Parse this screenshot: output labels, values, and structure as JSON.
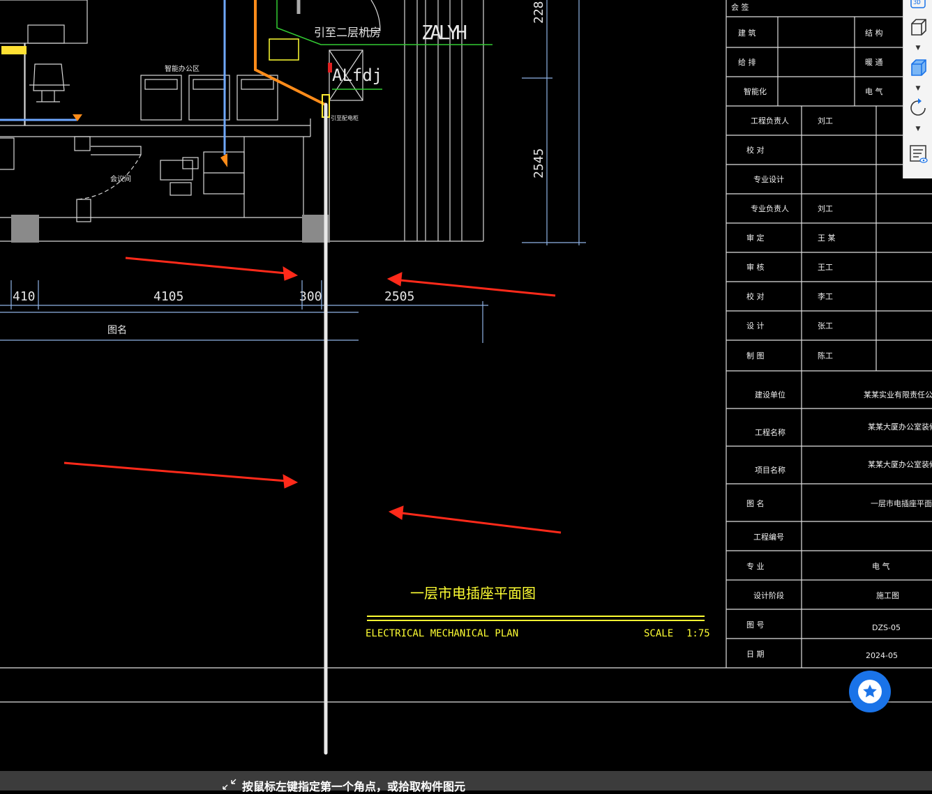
{
  "drawing": {
    "labels": {
      "to_machine_room": "引至二层机房",
      "zalyh": "ZALYH",
      "alfdj": "ALfdj",
      "intelligent_office": "智能办公区",
      "meeting_room": "会议间",
      "small_label": "引至配电柜"
    },
    "dimensions": {
      "d410": "410",
      "d4105": "4105",
      "d300": "300",
      "d2505": "2505",
      "d2545": "2545",
      "d228": "228",
      "figure_name": "图名"
    },
    "plan_title": "一层市电插座平面图",
    "plan_subtitle": "ELECTRICAL  MECHANICAL  PLAN",
    "scale_label": "SCALE",
    "scale_value": "1:75"
  },
  "title_block": {
    "rows": [
      {
        "k": "会 签",
        "v": ""
      },
      {
        "k": "建 筑",
        "v": "",
        "k2": "结 构"
      },
      {
        "k": "给 排",
        "v": "",
        "k2": "暖 通"
      },
      {
        "k": "智能化",
        "v": "",
        "k2": "电 气"
      },
      {
        "k": "工程负责人",
        "v": "刘工"
      },
      {
        "k": "校 对",
        "v": ""
      },
      {
        "k": "专业设计",
        "v": ""
      },
      {
        "k": "专业负责人",
        "v": "刘工"
      },
      {
        "k": "审 定",
        "v": "王 某"
      },
      {
        "k": "审 核",
        "v": "王工"
      },
      {
        "k": "校 对",
        "v": "李工"
      },
      {
        "k": "设 计",
        "v": "张工"
      },
      {
        "k": "制 图",
        "v": "陈工"
      },
      {
        "k": "建设单位",
        "v": "某某实业有限责任公司"
      },
      {
        "k": "工程名称",
        "v": "某某大厦办公室装修工程"
      },
      {
        "k": "项目名称",
        "v": "某某大厦办公室装修工程"
      },
      {
        "k": "图 名",
        "v": "一层市电插座平面图"
      },
      {
        "k": "工程编号",
        "v": ""
      },
      {
        "k": "专 业",
        "v": "电 气"
      },
      {
        "k": "设计阶段",
        "v": "施工图"
      },
      {
        "k": "图 号",
        "v": "DZS-05"
      },
      {
        "k": "日 期",
        "v": "2024-05"
      }
    ]
  },
  "toolbar": {
    "view3d_icon": "3d-view-icon",
    "cube_wire_icon": "cube-outline-icon",
    "cube_solid_icon": "cube-solid-icon",
    "rotate_icon": "rotate-icon",
    "properties_icon": "properties-view-icon"
  },
  "status_bar": {
    "prompt": "按鼠标左键指定第一个角点，或拾取构件图元"
  },
  "colors": {
    "background": "#000000",
    "dimension": "#8fb3e6",
    "annotation_arrow": "#ff2a1a",
    "cable_orange": "#ff8c1a",
    "cable_blue": "#6fa8ff",
    "cable_green": "#33cc33",
    "fav_button": "#1a73e8"
  }
}
